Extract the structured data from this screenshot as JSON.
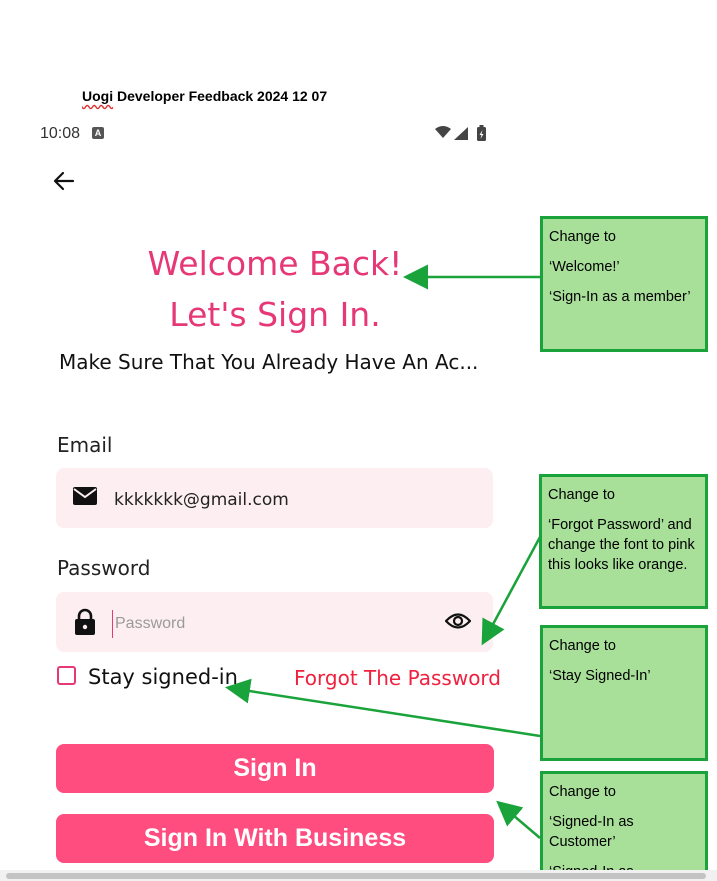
{
  "doc": {
    "title_first": "Uogi",
    "title_rest": " Developer Feedback 2024 12 07"
  },
  "status_bar": {
    "time": "10:08",
    "a_badge": "A",
    "icons": [
      "wifi-icon",
      "signal-icon",
      "battery-icon"
    ]
  },
  "header": {
    "back_icon": "arrow-left-icon"
  },
  "welcome": {
    "line1": "Welcome Back!",
    "line2": "Let's Sign In.",
    "subtitle": "Make Sure That You Already Have An Ac..."
  },
  "email": {
    "label": "Email",
    "value": "kkkkkkk@gmail.com",
    "icon": "mail-icon"
  },
  "password": {
    "label": "Password",
    "placeholder": "Password",
    "icon": "lock-icon",
    "toggle_icon": "eye-icon"
  },
  "options": {
    "stay_signed_in": "Stay signed-in",
    "stay_checked": false,
    "forgot": "Forgot The Password"
  },
  "buttons": {
    "sign_in": "Sign In",
    "sign_in_business": "Sign In With Business"
  },
  "notes": [
    {
      "lines": [
        "Change to",
        "‘Welcome!’",
        "‘Sign-In as a member’"
      ]
    },
    {
      "lines": [
        "Change to",
        "‘Forgot Password’ and change the font to pink this looks like orange."
      ]
    },
    {
      "lines": [
        "Change to",
        "‘Stay Signed-In’"
      ]
    },
    {
      "lines": [
        "Change to",
        "‘Signed-In as Customer’",
        "‘Signed-In as"
      ]
    }
  ],
  "colors": {
    "brand_pink": "#e63776",
    "button_pink": "#ff4d80",
    "forgot_red": "#f0203f",
    "field_bg": "#fdeff1",
    "note_bg": "#a8e09a",
    "note_border": "#1aa33a"
  }
}
